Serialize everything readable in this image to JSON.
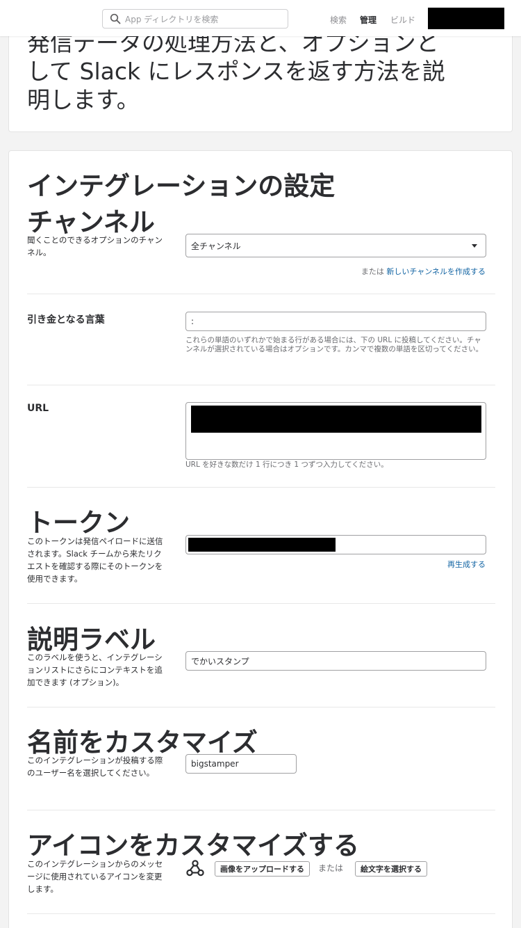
{
  "header": {
    "search_placeholder": "App ディレクトリを検索",
    "nav": {
      "search": "検索",
      "manage": "管理",
      "build": "ビルド"
    }
  },
  "intro": {
    "text": "発信データの処理方法と、オプションとして Slack にレスポンスを返す方法を説明します。"
  },
  "main": {
    "section_title": "インテグレーションの設定",
    "channel": {
      "title": "チャンネル",
      "desc": "聞くことのできるオプションのチャンネル。",
      "selected": "全チャンネル",
      "or": "または",
      "create_link": "新しいチャンネルを作成する"
    },
    "trigger": {
      "label": "引き金となる言葉",
      "value": ":",
      "hint": "これらの単語のいずれかで始まる行がある場合には、下の URL に投稿してください。チャンネルが選択されている場合はオプションです。カンマで複数の単語を区切ってください。"
    },
    "url": {
      "label": "URL",
      "hint": "URL を好きな数だけ 1 行につき 1 つずつ入力してください。"
    },
    "token": {
      "title": "トークン",
      "desc": "このトークンは発信ペイロードに送信されます。Slack チームから来たリクエストを確認する際にそのトークンを使用できます。",
      "regenerate": "再生成する"
    },
    "desc_label": {
      "title": "説明ラベル",
      "desc": "このラベルを使うと、インテグレーションリストにさらにコンテキストを追加できます (オプション)。",
      "value": "でかいスタンプ"
    },
    "custom_name": {
      "title": "名前をカスタマイズ",
      "desc": "このインテグレーションが投稿する際のユーザー名を選択してください。",
      "value": "bigstamper"
    },
    "custom_icon": {
      "title": "アイコンをカスタマイズする",
      "desc": "このインテグレーションからのメッセージに使用されているアイコンを変更します。",
      "upload": "画像をアップロードする",
      "or": "または",
      "emoji": "絵文字を選択する"
    }
  },
  "colors": {
    "link": "#1264a3",
    "text": "#2c2d30"
  }
}
